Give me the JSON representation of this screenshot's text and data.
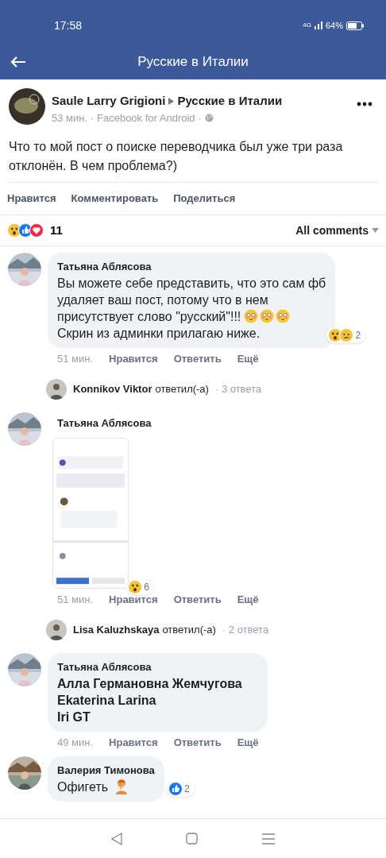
{
  "status_bar": {
    "time": "17:58",
    "network": "4G",
    "battery": "64%"
  },
  "header": {
    "title": "Русские в Италии"
  },
  "post": {
    "author": "Saule Larry Grigioni",
    "group": "Русские в Италии",
    "time": "53 мин.",
    "source": "· Facebook for Android ·",
    "text": "Что то мой пост о поиске переводчика был уже три раза отклонён. В чем проблема?)",
    "actions": [
      "Нравится",
      "Комментировать",
      "Поделиться"
    ],
    "reaction_count": "11",
    "sort": "All comments"
  },
  "comments": [
    {
      "kind": "text",
      "author": "Татьяна Аблясова",
      "lines": [
        "Вы можете себе представить, что это сам фб",
        "удаляет ваш пост, потому что в нем",
        "присутствует слово \"русский\"!!!",
        "Скрин из админки прилагаю ниже."
      ],
      "reaction_count": "2",
      "time": "51 мин.",
      "actions": [
        "Нравится",
        "Ответить",
        "Ещё"
      ],
      "reply": {
        "author": "Konnikov Viktor",
        "verb": "ответил(-а)",
        "count": "· 3 ответа"
      }
    },
    {
      "author": "Татьяна Аблясова",
      "reaction_count": "6",
      "time": "51 мин.",
      "actions": [
        "Нравится",
        "Ответить",
        "Ещё"
      ],
      "reply": {
        "author": "Lisa Kaluzhskaya",
        "verb": "ответил(-а)",
        "count": "· 2 ответа"
      }
    },
    {
      "kind": "mentions",
      "author": "Татьяна Аблясова",
      "lines": [
        "Алла Германовна Жемчугова",
        "Ekaterina Larina",
        "Iri GT"
      ],
      "time": "49 мин.",
      "actions": [
        "Нравится",
        "Ответить",
        "Ещё"
      ]
    },
    {
      "kind": "text",
      "author": "Валерия Тимонова",
      "lines": [
        "Офигеть"
      ],
      "reaction_count": "2"
    }
  ]
}
